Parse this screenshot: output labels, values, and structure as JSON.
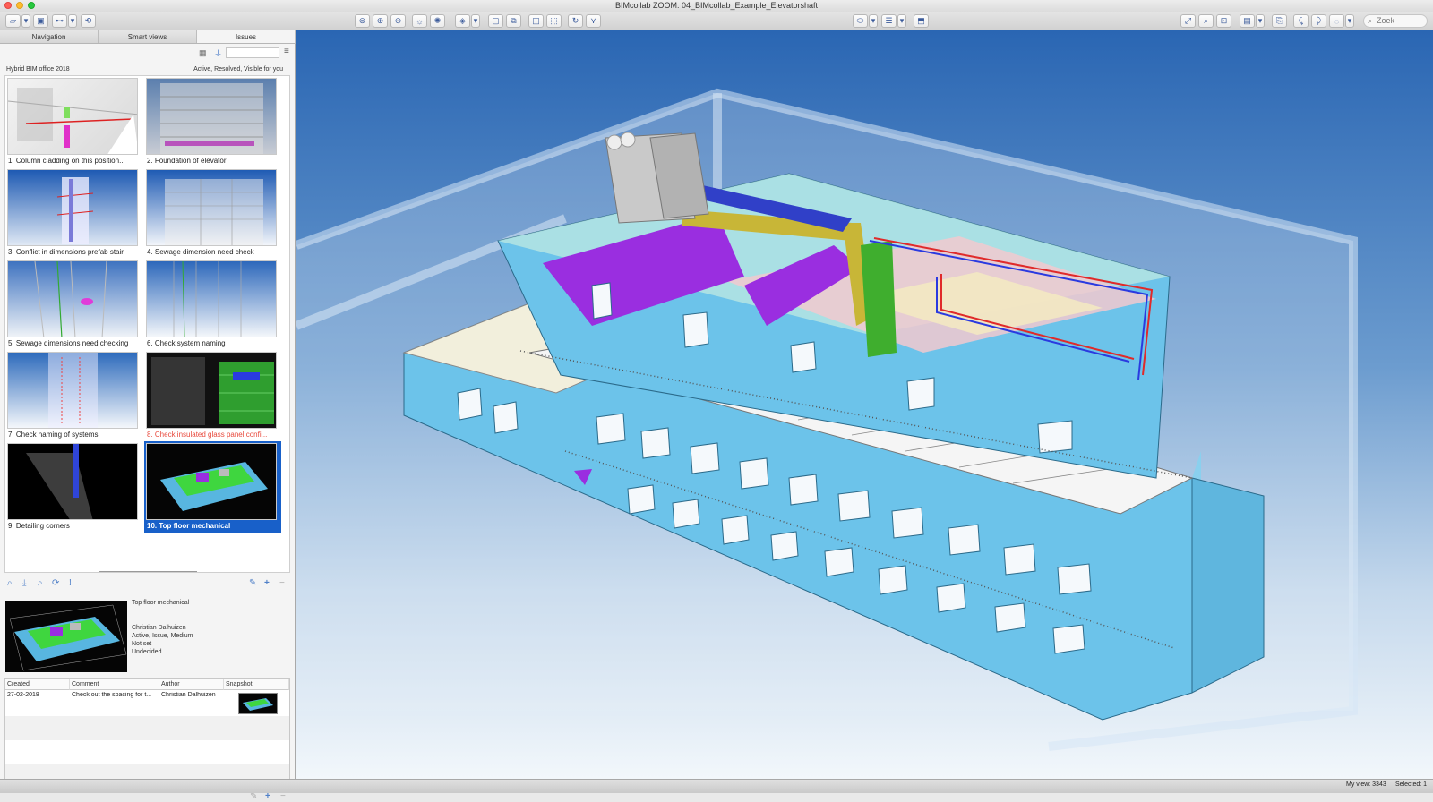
{
  "window": {
    "title": "BIMcollab ZOOM: 04_BIMcollab_Example_Elevatorshaft"
  },
  "toolbar": {
    "search_placeholder": "Zoek"
  },
  "tabs": [
    {
      "label": "Navigation"
    },
    {
      "label": "Smart views"
    },
    {
      "label": "Issues"
    }
  ],
  "issues_panel": {
    "project": "Hybrid BIM office 2018",
    "filter_status": "Active, Resolved, Visible for you",
    "issues": [
      {
        "label": "1. Column cladding on this position..."
      },
      {
        "label": "2. Foundation of elevator"
      },
      {
        "label": "3. Conflict in dimensions prefab stair"
      },
      {
        "label": "4. Sewage dimension need check"
      },
      {
        "label": "5. Sewage dimensions need checking"
      },
      {
        "label": "6. Check system naming"
      },
      {
        "label": "7. Check naming of systems"
      },
      {
        "label": "8. Check insulated glass panel confi..."
      },
      {
        "label": "9. Detailing corners"
      },
      {
        "label": "10. Top floor mechanical"
      }
    ]
  },
  "selected_issue": {
    "title": "Top floor mechanical",
    "author": "Christian Dalhuizen",
    "meta": "Active, Issue, Medium",
    "due": "Not set",
    "milestone": "Undecided"
  },
  "comments_table": {
    "headers": [
      "Created",
      "Comment",
      "Author",
      "Snapshot"
    ],
    "rows": [
      {
        "created": "27-02-2018",
        "comment": "Check out the spacing for t...",
        "author": "Christian Dalhuizen"
      }
    ]
  },
  "status_bar": {
    "view": "My view: 3343",
    "selected": "Selected: 1"
  },
  "colors": {
    "selection": "#1860c9",
    "flagged_text": "#e8483b",
    "building_wall": "#6cc3ea",
    "duct_purple": "#9a2ee0",
    "duct_green": "#3fae2e"
  }
}
